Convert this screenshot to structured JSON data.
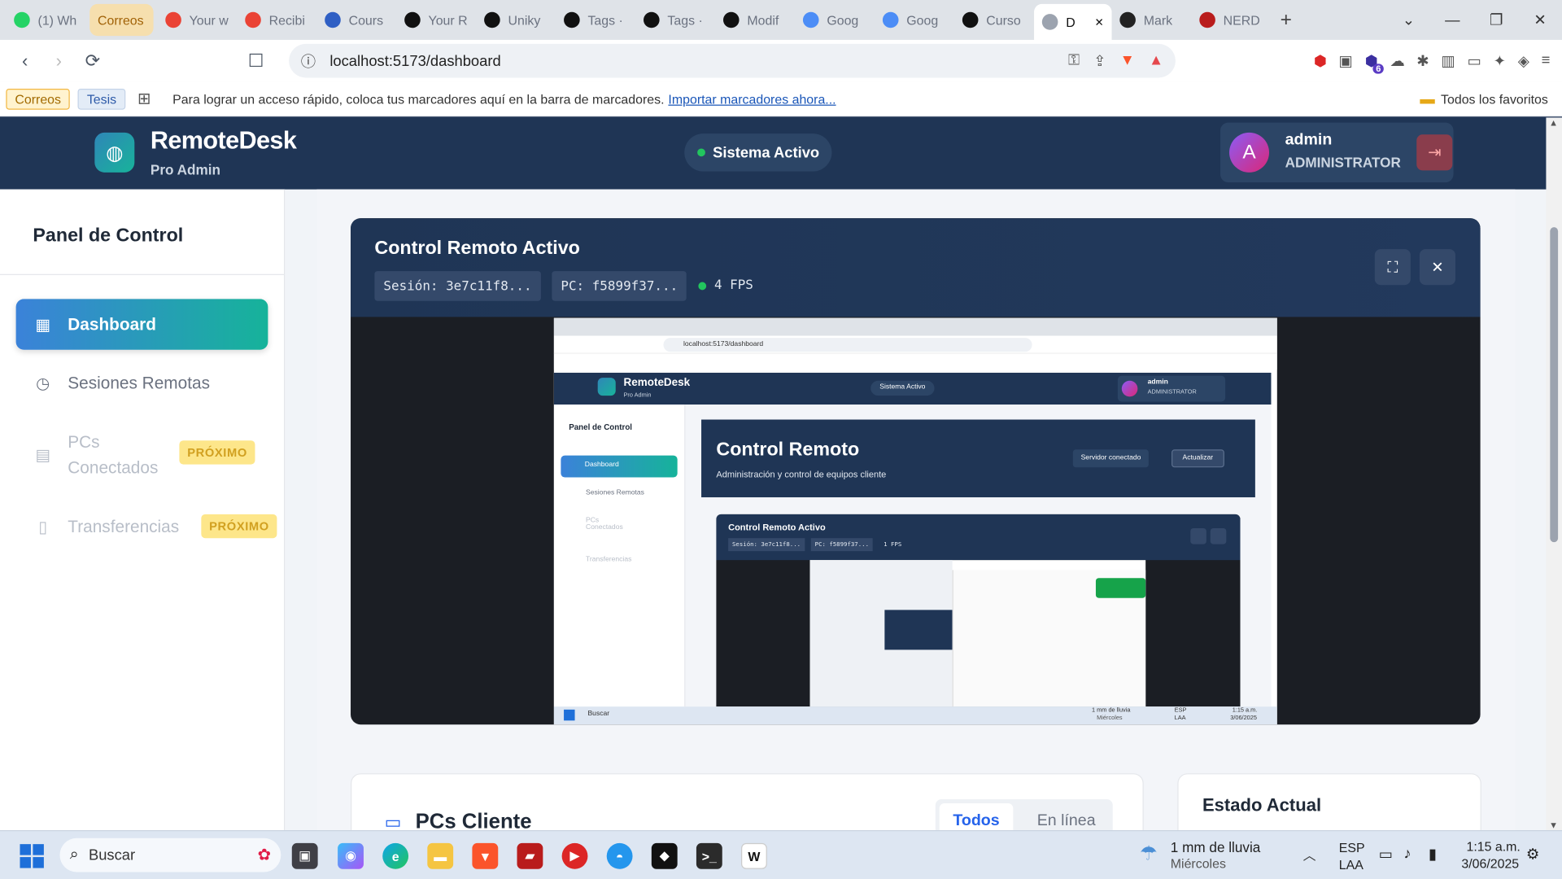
{
  "browser": {
    "tabs": [
      {
        "label": "(1) Wh",
        "color": "#25d366"
      },
      {
        "label": "Correos",
        "color": "#f2b742",
        "pill": true
      },
      {
        "label": "Your w",
        "color": "#ea4335"
      },
      {
        "label": "Recibi",
        "color": "#ea4335"
      },
      {
        "label": "Cours",
        "color": "#2f5fc4"
      },
      {
        "label": "Your R",
        "color": "#111111"
      },
      {
        "label": "Uniky",
        "color": "#111111"
      },
      {
        "label": "Tags ·",
        "color": "#111111"
      },
      {
        "label": "Tags ·",
        "color": "#111111"
      },
      {
        "label": "Modif",
        "color": "#111111"
      },
      {
        "label": "Goog",
        "color": "#4c8df6"
      },
      {
        "label": "Goog",
        "color": "#4c8df6"
      },
      {
        "label": "Curso",
        "color": "#111111"
      },
      {
        "label": "D",
        "color": "#9ca3af",
        "active": true
      },
      {
        "label": "Mark",
        "color": "#222222"
      },
      {
        "label": "NERD",
        "color": "#b91c1c"
      }
    ],
    "url": "localhost:5173/dashboard",
    "bookmarks": {
      "chip1": "Correos",
      "chip2": "Tesis",
      "hint": "Para lograr un acceso rápido, coloca tus marcadores aquí en la barra de marcadores.",
      "import_link": "Importar marcadores ahora...",
      "all_favorites": "Todos los favoritos"
    },
    "ext_badge": "6"
  },
  "header": {
    "brand": "RemoteDesk",
    "subtitle": "Pro Admin",
    "status": "Sistema Activo",
    "user": {
      "initial": "A",
      "name": "admin",
      "role": "ADMINISTRATOR"
    }
  },
  "sidebar": {
    "title": "Panel de Control",
    "items": [
      {
        "label": "Dashboard"
      },
      {
        "label": "Sesiones Remotas"
      },
      {
        "label": "PCs Conectados",
        "line1": "PCs",
        "line2": "Conectados",
        "badge": "PRÓXIMO"
      },
      {
        "label": "Transferencias",
        "badge": "PRÓXIMO"
      }
    ]
  },
  "remote_panel": {
    "title": "Control Remoto Activo",
    "session": "Sesión: 3e7c11f8...",
    "pc": "PC: f5899f37...",
    "fps": "4 FPS",
    "nested": {
      "url": "localhost:5173/dashboard",
      "brand": "RemoteDesk",
      "subtitle": "Pro Admin",
      "status": "Sistema Activo",
      "user_name": "admin",
      "user_role": "ADMINISTRATOR",
      "panel_title": "Panel de Control",
      "nav": [
        "Dashboard",
        "Sesiones Remotas",
        "PCs Conectados",
        "Transferencias"
      ],
      "hero_title": "Control Remoto",
      "hero_sub": "Administración y control de equipos cliente",
      "btn_server": "Servidor conectado",
      "btn_refresh": "Actualizar",
      "inner_title": "Control Remoto Activo",
      "inner_session": "Sesión: 3e7c11f8...",
      "inner_pc": "PC: f5899f37...",
      "inner_fps": "1 FPS",
      "search": "Buscar",
      "weather": "1 mm de lluvia",
      "weather_day": "Miércoles",
      "lang1": "ESP",
      "lang2": "LAA",
      "time": "1:15 a.m.",
      "date": "3/06/2025"
    }
  },
  "sections": {
    "clients_title": "PCs Cliente",
    "filter_all": "Todos",
    "filter_online": "En línea",
    "status_title": "Estado Actual"
  },
  "taskbar": {
    "search": "Buscar",
    "weather": "1 mm de lluvia",
    "weather_day": "Miércoles",
    "lang1": "ESP",
    "lang2": "LAA",
    "time": "1:15 a.m.",
    "date": "3/06/2025"
  },
  "colors": {
    "header_bg": "#1f3555",
    "accent_gradient_start": "#3b82d9",
    "accent_gradient_end": "#16b39a",
    "badge_bg": "#fde68a",
    "status_dot": "#22c55e"
  }
}
